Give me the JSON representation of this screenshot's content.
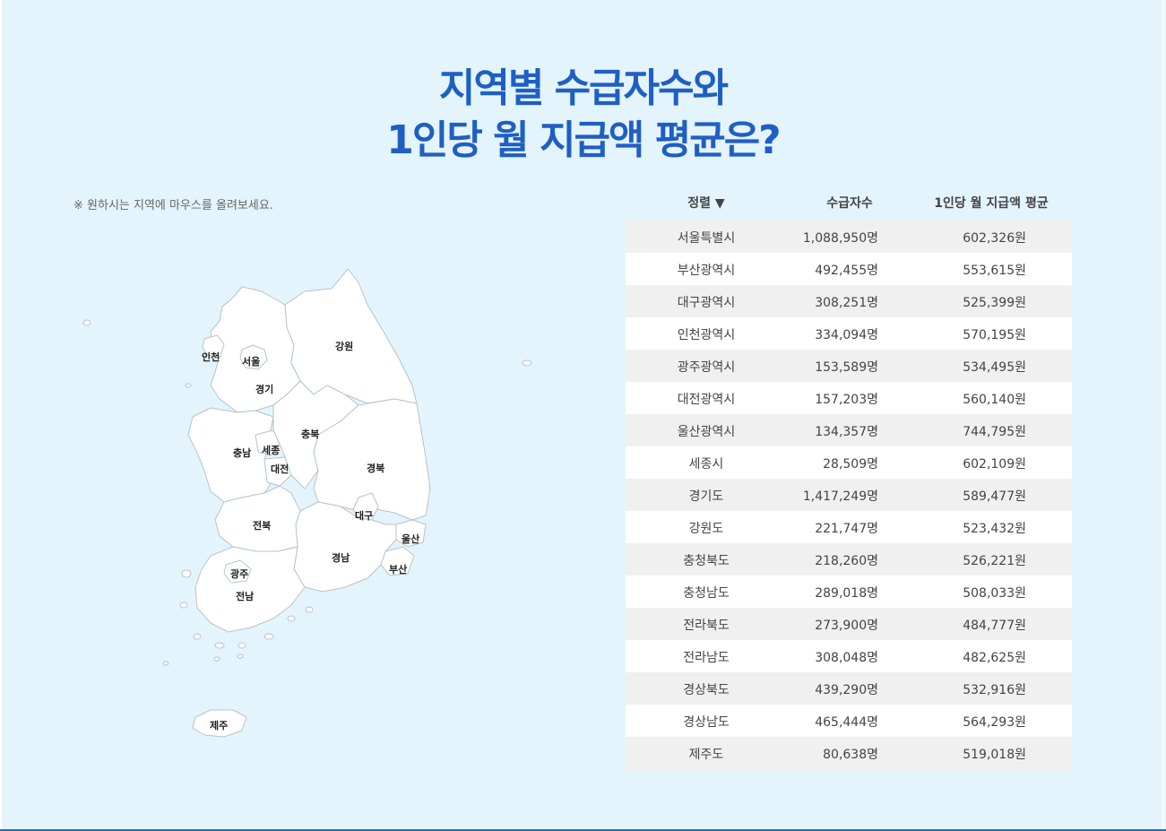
{
  "title": {
    "line1": "지역별 수급자수와",
    "line2": "1인당 월 지급액 평균은?"
  },
  "hint": "※ 원하시는 지역에 마우스를 올려보세요.",
  "table": {
    "header": {
      "sort": "정렬 ▼",
      "count": "수급자수",
      "amount": "1인당 월 지급액 평균"
    },
    "rows": [
      {
        "name": "서울특별시",
        "count": "1,088,950명",
        "amount": "602,326원"
      },
      {
        "name": "부산광역시",
        "count": "492,455명",
        "amount": "553,615원"
      },
      {
        "name": "대구광역시",
        "count": "308,251명",
        "amount": "525,399원"
      },
      {
        "name": "인천광역시",
        "count": "334,094명",
        "amount": "570,195원"
      },
      {
        "name": "광주광역시",
        "count": "153,589명",
        "amount": "534,495원"
      },
      {
        "name": "대전광역시",
        "count": "157,203명",
        "amount": "560,140원"
      },
      {
        "name": "울산광역시",
        "count": "134,357명",
        "amount": "744,795원"
      },
      {
        "name": "세종시",
        "count": "28,509명",
        "amount": "602,109원"
      },
      {
        "name": "경기도",
        "count": "1,417,249명",
        "amount": "589,477원"
      },
      {
        "name": "강원도",
        "count": "221,747명",
        "amount": "523,432원"
      },
      {
        "name": "충청북도",
        "count": "218,260명",
        "amount": "526,221원"
      },
      {
        "name": "충청남도",
        "count": "289,018명",
        "amount": "508,033원"
      },
      {
        "name": "전라북도",
        "count": "273,900명",
        "amount": "484,777원"
      },
      {
        "name": "전라남도",
        "count": "308,048명",
        "amount": "482,625원"
      },
      {
        "name": "경상북도",
        "count": "439,290명",
        "amount": "532,916원"
      },
      {
        "name": "경상남도",
        "count": "465,444명",
        "amount": "564,293원"
      },
      {
        "name": "제주도",
        "count": "80,638명",
        "amount": "519,018원"
      }
    ]
  },
  "map": {
    "labels": {
      "incheon": "인천",
      "seoul": "서울",
      "gyeonggi": "경기",
      "gangwon": "강원",
      "chungnam": "충남",
      "sejong": "세종",
      "daejeon": "대전",
      "chungbuk": "충북",
      "gyeongbuk": "경북",
      "daegu": "대구",
      "jeonbuk": "전북",
      "ulsan": "울산",
      "gyeongnam": "경남",
      "busan": "부산",
      "gwangju": "광주",
      "jeonnam": "전남",
      "jeju": "제주"
    }
  }
}
